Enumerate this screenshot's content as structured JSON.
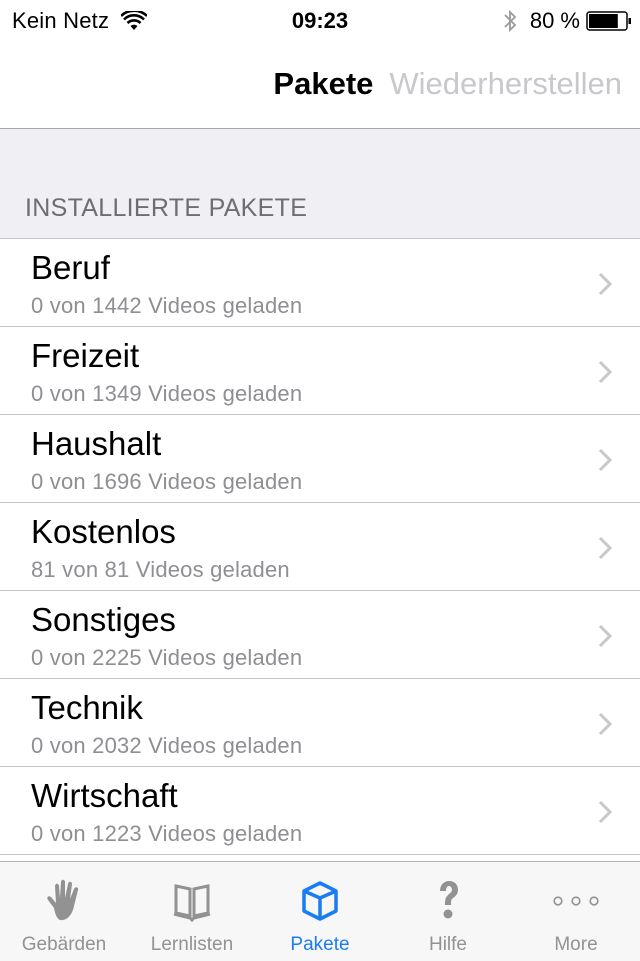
{
  "status_bar": {
    "carrier": "Kein Netz",
    "wifi_icon": "wifi-icon",
    "time": "09:23",
    "bluetooth_icon": "bluetooth-icon",
    "battery_percent": "80 %",
    "battery_level": 0.8,
    "battery_icon": "battery-icon"
  },
  "navbar": {
    "segments": [
      {
        "label": "Pakete",
        "active": true
      },
      {
        "label": "Wiederherstellen",
        "active": false
      }
    ]
  },
  "section": {
    "header": "INSTALLIERTE PAKETE",
    "items": [
      {
        "title": "Beruf",
        "subtitle": "0 von 1442 Videos geladen",
        "loaded": 0,
        "total": 1442
      },
      {
        "title": "Freizeit",
        "subtitle": "0 von 1349 Videos geladen",
        "loaded": 0,
        "total": 1349
      },
      {
        "title": "Haushalt",
        "subtitle": "0 von 1696 Videos geladen",
        "loaded": 0,
        "total": 1696
      },
      {
        "title": "Kostenlos",
        "subtitle": "81 von 81 Videos geladen",
        "loaded": 81,
        "total": 81
      },
      {
        "title": "Sonstiges",
        "subtitle": "0 von 2225 Videos geladen",
        "loaded": 0,
        "total": 2225
      },
      {
        "title": "Technik",
        "subtitle": "0 von 2032 Videos geladen",
        "loaded": 0,
        "total": 2032
      },
      {
        "title": "Wirtschaft",
        "subtitle": "0 von 1223 Videos geladen",
        "loaded": 0,
        "total": 1223
      }
    ]
  },
  "tabbar": {
    "active_color": "#1a7cf2",
    "inactive_color": "#929292",
    "tabs": [
      {
        "label": "Gebärden",
        "icon": "hand-icon",
        "active": false
      },
      {
        "label": "Lernlisten",
        "icon": "book-icon",
        "active": false
      },
      {
        "label": "Pakete",
        "icon": "cube-icon",
        "active": true
      },
      {
        "label": "Hilfe",
        "icon": "question-mark-icon",
        "active": false
      },
      {
        "label": "More",
        "icon": "more-dots-icon",
        "active": false
      }
    ]
  }
}
